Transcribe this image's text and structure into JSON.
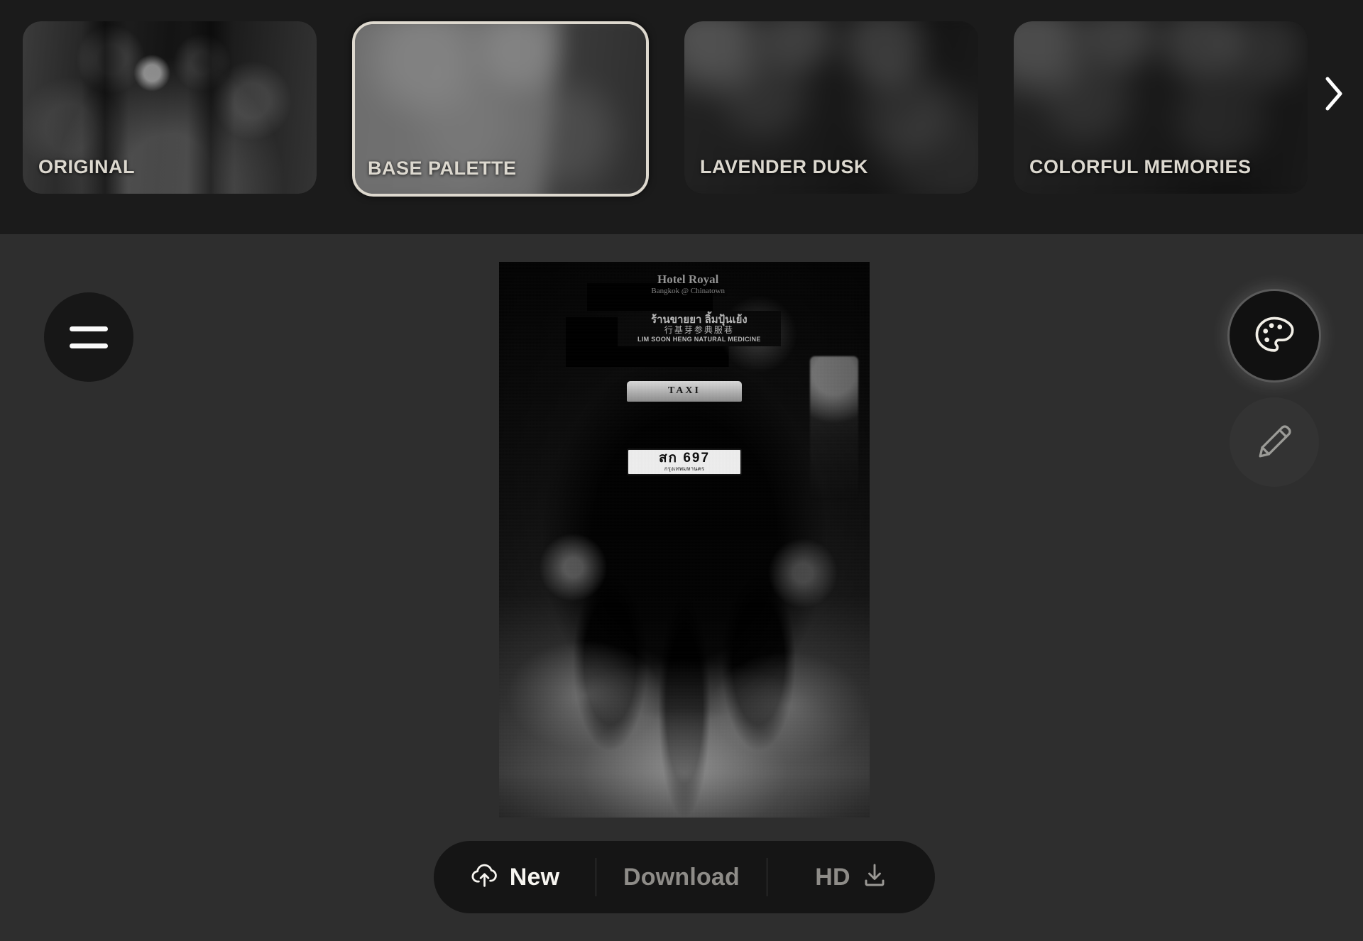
{
  "app": {
    "background_color": "#2e2e2e",
    "strip_color": "#1b1b1b",
    "accent_color": "#ded9cf"
  },
  "filter_strip": {
    "scroll_next_icon": "chevron-right-icon",
    "items": [
      {
        "label": "ORIGINAL",
        "selected": false,
        "thumbnail": "original-street-photo"
      },
      {
        "label": "BASE PALETTE",
        "selected": true,
        "thumbnail": "blurred-light-gray-palette"
      },
      {
        "label": "LAVENDER DUSK",
        "selected": false,
        "thumbnail": "blurred-dark-dusk"
      },
      {
        "label": "COLORFUL MEMORIES",
        "selected": false,
        "thumbnail": "blurred-dark-memories"
      }
    ]
  },
  "canvas": {
    "menu_button": {
      "icon": "hamburger-menu-icon"
    },
    "tools": [
      {
        "name": "palette",
        "icon": "palette-icon",
        "active": true
      },
      {
        "name": "edit",
        "icon": "pencil-icon",
        "active": false
      }
    ],
    "photo": {
      "alt": "black-and-white night photo of a tuk-tuk taxi on a Bangkok Chinatown street",
      "hotel_sign": "Hotel Royal",
      "hotel_sign_sub": "Bangkok @ Chinatown",
      "shop_sign_thai": "ร้านขายยา ลิ้มปุ้นเย้ง",
      "shop_sign_cjk": "行基芽参典服巷",
      "shop_sign_roman": "LIM SOON HENG NATURAL MEDICINE",
      "taxi_sign": "TAXI",
      "plate_number": "สก 697",
      "plate_province": "กรุงเทพมหานคร"
    }
  },
  "action_bar": {
    "new": {
      "label": "New",
      "icon": "cloud-upload-icon"
    },
    "download": {
      "label": "Download"
    },
    "hd": {
      "label": "HD",
      "icon": "download-icon"
    }
  }
}
